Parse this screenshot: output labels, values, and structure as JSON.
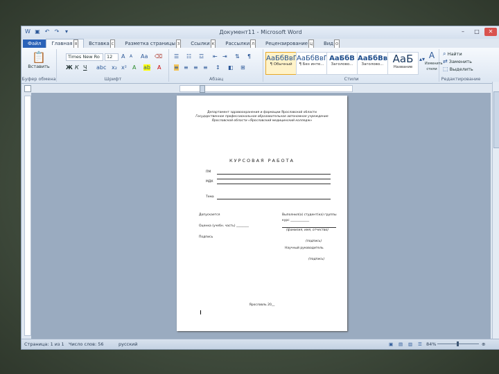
{
  "window": {
    "title": "Документ11 - Microsoft Word",
    "controls": [
      "–",
      "□",
      "✕"
    ]
  },
  "tabs": [
    {
      "label": "Файл",
      "key": ""
    },
    {
      "label": "Главная",
      "key": "Я"
    },
    {
      "label": "Вставка",
      "key": "С"
    },
    {
      "label": "Разметка страницы",
      "key": "З"
    },
    {
      "label": "Ссылки",
      "key": "К"
    },
    {
      "label": "Рассылки",
      "key": "Л"
    },
    {
      "label": "Рецензирование",
      "key": "Ц"
    },
    {
      "label": "Вид",
      "key": "О"
    }
  ],
  "ribbon": {
    "clipboard": {
      "paste": "Вставить",
      "label": "Буфер обмена"
    },
    "font": {
      "name": "Times New Ro",
      "size": "12",
      "label": "Шрифт",
      "bold": "Ж",
      "italic": "К",
      "underline": "Ч"
    },
    "paragraph": {
      "label": "Абзац",
      "pilcrow": "¶"
    },
    "styles": {
      "label": "Стили",
      "items": [
        {
          "sample": "АаБбВвГ",
          "name": "¶ Обычный"
        },
        {
          "sample": "АаБбВвГ",
          "name": "¶ Без инте..."
        },
        {
          "sample": "АаБбВ",
          "name": "Заголово..."
        },
        {
          "sample": "АаБбВв",
          "name": "Заголово..."
        },
        {
          "sample": "АаБ",
          "name": "Название"
        }
      ],
      "change": "Изменить стили"
    },
    "editing": {
      "find": "Найти",
      "replace": "Заменить",
      "select": "Выделить",
      "label": "Редактирование"
    }
  },
  "document": {
    "header": [
      "Департамент здравоохранения и фармации Ярославской области",
      "Государственное профессиональное образовательное автономное учреждение",
      "Ярославской области «Ярославский медицинский колледж»"
    ],
    "title": "КУРСОВАЯ РАБОТА",
    "fields": [
      "ПМ",
      "МДК",
      "Тема"
    ],
    "left_block": [
      "Допускается",
      "Оценка (учебн. часть) ________",
      "Подпись"
    ],
    "right_block": [
      "Выполнил(а) студент(ка) группы",
      "курс ____________",
      "(фамилия, имя, отчество)",
      "(подпись)",
      "Научный руководитель",
      "(подпись)"
    ],
    "footer": "Ярославль 20__"
  },
  "status": {
    "page": "Страница: 1 из 1",
    "words": "Число слов: 56",
    "language": "русский",
    "zoom": "84%"
  }
}
